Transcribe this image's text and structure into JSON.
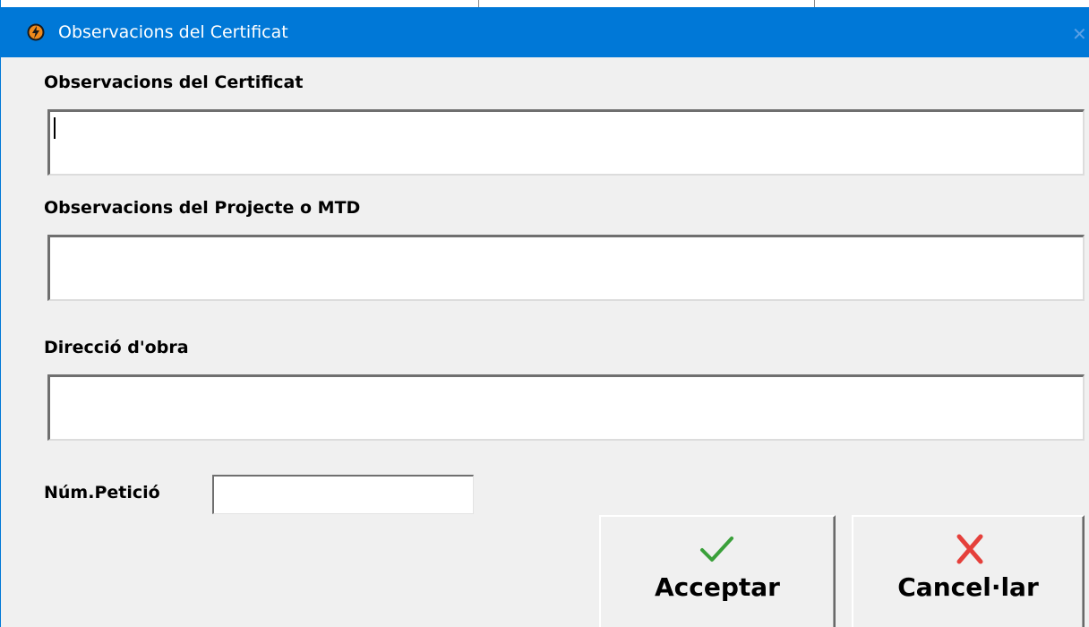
{
  "window": {
    "title": "Observacions del Certificat",
    "accent_color": "#0078d7",
    "app_icon": "app-logo-icon",
    "close_icon": "close-icon"
  },
  "fields": {
    "certificat": {
      "label": "Observacions del Certificat",
      "value": ""
    },
    "projecte": {
      "label": "Observacions del Projecte o MTD",
      "value": ""
    },
    "direccio": {
      "label": "Direcció d'obra",
      "value": ""
    },
    "num_peticio": {
      "label": "Núm.Petició",
      "value": ""
    }
  },
  "buttons": {
    "accept": {
      "label": "Acceptar",
      "icon": "checkmark-icon",
      "icon_color": "#3aa03a"
    },
    "cancel": {
      "label": "Cancel·lar",
      "icon": "x-cross-icon",
      "icon_color": "#e5403b"
    }
  }
}
